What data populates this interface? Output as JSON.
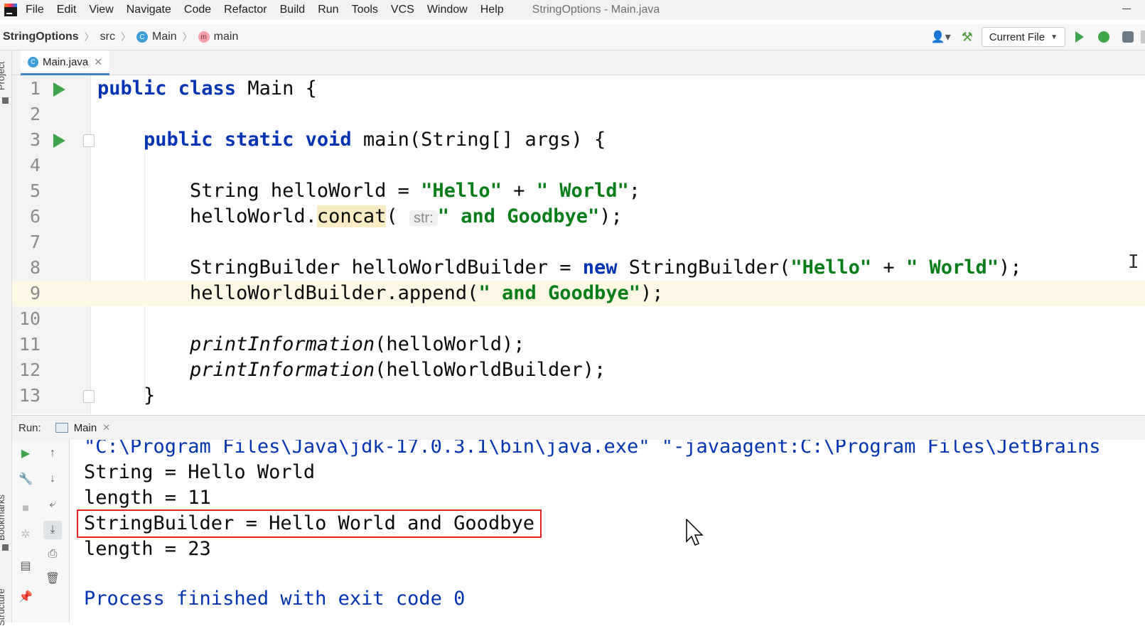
{
  "menubar": {
    "items": [
      "File",
      "Edit",
      "View",
      "Navigate",
      "Code",
      "Refactor",
      "Build",
      "Run",
      "Tools",
      "VCS",
      "Window",
      "Help"
    ],
    "window_title": "StringOptions - Main.java"
  },
  "navbar": {
    "project": "StringOptions",
    "src": "src",
    "class": "Main",
    "method": "main",
    "run_config": "Current File"
  },
  "side_labels": {
    "project": "Project",
    "bookmarks": "Bookmarks",
    "structure": "Structure"
  },
  "editor_tab": {
    "label": "Main.java"
  },
  "editor": {
    "current_line": 9,
    "lines": [
      {
        "n": "1"
      },
      {
        "n": "2"
      },
      {
        "n": "3"
      },
      {
        "n": "4"
      },
      {
        "n": "5"
      },
      {
        "n": "6"
      },
      {
        "n": "7"
      },
      {
        "n": "8"
      },
      {
        "n": "9"
      },
      {
        "n": "10"
      },
      {
        "n": "11"
      },
      {
        "n": "12"
      },
      {
        "n": "13"
      }
    ],
    "tokens": {
      "l1_kw": "public class",
      "l1_rest": " Main {",
      "l3_kw": "public static void",
      "l3_rest": " main(String[] args) {",
      "l5_a": "String helloWorld = ",
      "l5_s1": "\"Hello\"",
      "l5_b": " + ",
      "l5_s2": "\" World\"",
      "l5_c": ";",
      "l6_a": "helloWorld.",
      "l6_m": "concat",
      "l6_b": "(",
      "l6_hint": "str:",
      "l6_s": "\" and Goodbye\"",
      "l6_c": ");",
      "l8_a": "StringBuilder helloWorldBuilder = ",
      "l8_kw": "new",
      "l8_b": " StringBuilder(",
      "l8_s1": "\"Hello\"",
      "l8_c": " + ",
      "l8_s2": "\" World\"",
      "l8_d": ");",
      "l9_a": "helloWorldBuilder.append(",
      "l9_s": "\" and Goodbye\"",
      "l9_b": ");",
      "l11_m": "printInformation",
      "l11_b": "(helloWorld);",
      "l12_m": "printInformation",
      "l12_b": "(helloWorldBuilder);",
      "l13": "}"
    }
  },
  "run_panel": {
    "label": "Run:",
    "tab": "Main",
    "console": {
      "cmd": "\"C:\\Program Files\\Java\\jdk-17.0.3.1\\bin\\java.exe\" \"-javaagent:C:\\Program Files\\JetBrains",
      "out1": "String = Hello World",
      "out2": "length = 11",
      "out3": "StringBuilder = Hello World and Goodbye",
      "out4": "length = 23",
      "finish": "Process finished with exit code 0"
    }
  },
  "colors": {
    "keyword": "#0033b3",
    "string": "#067d17",
    "run_green": "#3ea54b",
    "highlight_box": "#e32424",
    "current_line": "#fcf8e3"
  }
}
